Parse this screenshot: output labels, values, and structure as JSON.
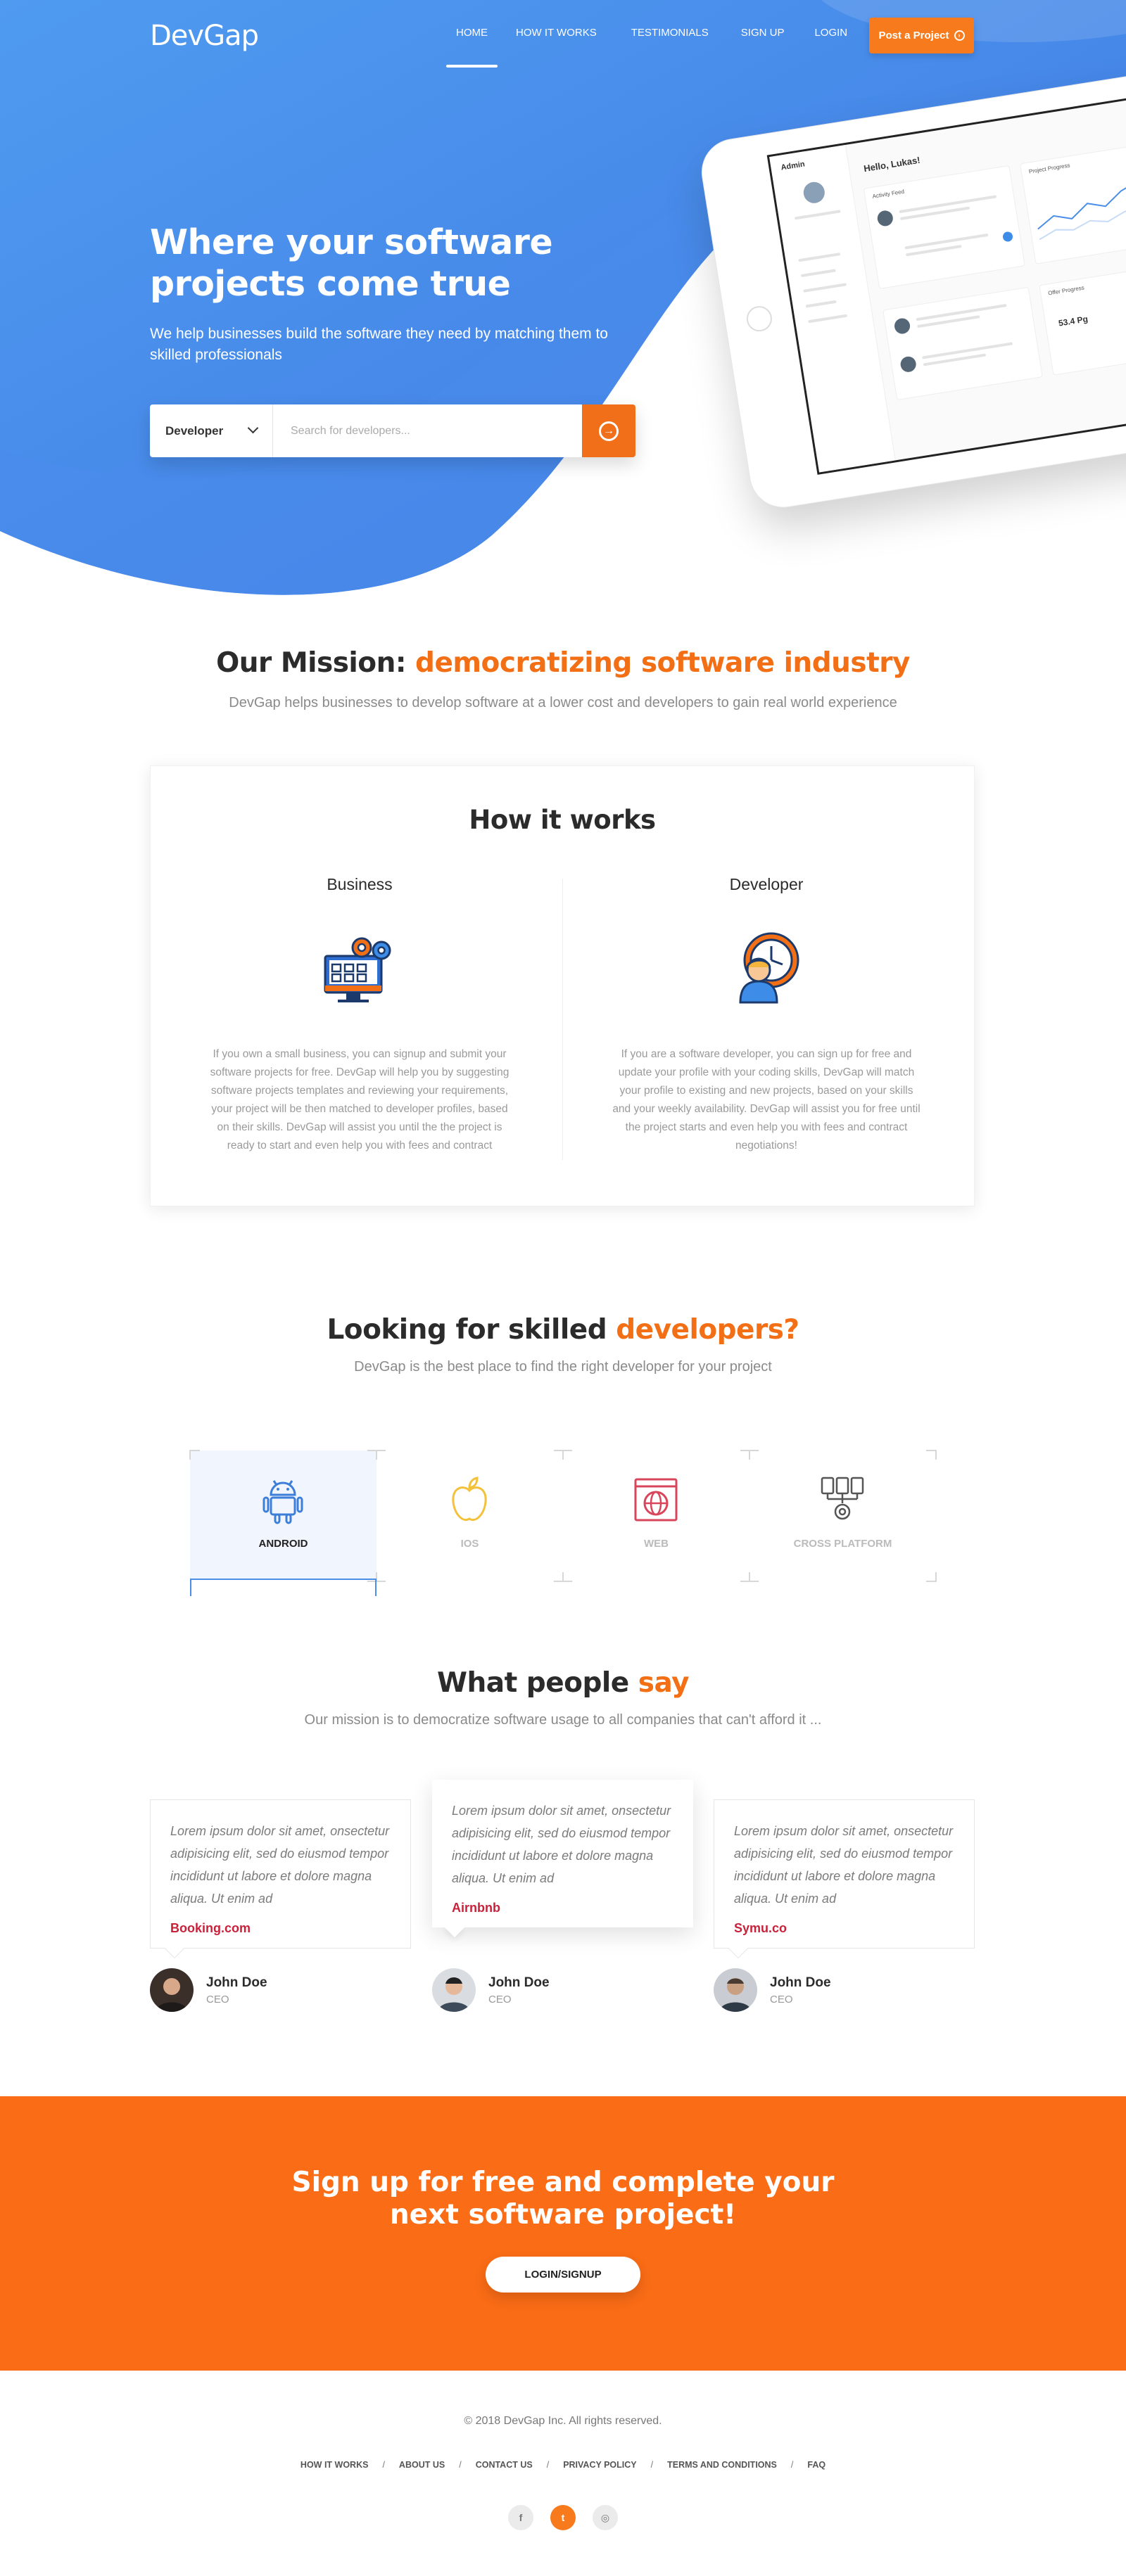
{
  "brand": {
    "logo": "DevGap",
    "accent": "#f36f16",
    "hero_blue": "#3f8be9"
  },
  "nav": {
    "items": [
      "HOME",
      "HOW IT WORKS",
      "TESTIMONIALS",
      "SIGN UP",
      "LOGIN"
    ],
    "active": "HOME",
    "post_button": "Post a Project"
  },
  "hero": {
    "title": "Where your software projects come true",
    "subtitle": "We help businesses build the software they need by matching them to skilled professionals",
    "search": {
      "selected": "Developer",
      "placeholder": "Search for developers...",
      "submit_icon": "arrow-circle-icon"
    }
  },
  "mission": {
    "title_start": "Our Mission:",
    "title_highlight": "democratizing software industry",
    "subtitle": "DevGap helps businesses to develop software at a lower cost and developers to gain real world experience"
  },
  "how": {
    "title": "How it works",
    "business": {
      "heading": "Business",
      "icon": "computer-gears-icon",
      "text": "If you own a small business, you can signup and submit your software projects for free. DevGap will help you by suggesting software projects templates and reviewing your requirements, your project will be then matched to developer profiles, based on their skills. DevGap will assist you until the the project is ready to start and even help you with fees and contract"
    },
    "developer": {
      "heading": "Developer",
      "icon": "developer-clock-icon",
      "text": "If you are a software developer, you can sign up for free and update your profile with your coding skills, DevGap will match your profile to existing and new projects, based on your skills and your weekly availability. DevGap will assist you for free until the project starts and even help you with fees and contract negotiations!"
    }
  },
  "developers": {
    "title_start": "Looking for skilled",
    "title_highlight": "developers?",
    "subtitle": "DevGap is the best place to find the right developer for your project",
    "categories": [
      {
        "label": "ANDROID",
        "icon": "android-icon",
        "active": true
      },
      {
        "label": "IOS",
        "icon": "apple-icon",
        "active": false
      },
      {
        "label": "WEB",
        "icon": "web-globe-icon",
        "active": false
      },
      {
        "label": "CROSS PLATFORM",
        "icon": "cross-platform-icon",
        "active": false
      }
    ]
  },
  "testimonials": {
    "title_start": "What people",
    "title_highlight": "say",
    "subtitle": "Our mission is to democratize software usage to all companies that can't afford it ...",
    "items": [
      {
        "quote": "Lorem ipsum dolor sit amet, onsectetur adipisicing elit, sed do eiusmod tempor incididunt ut labore et dolore magna aliqua. Ut enim ad",
        "company": "Booking.com",
        "name": "John Doe",
        "role": "CEO"
      },
      {
        "quote": "Lorem ipsum dolor sit amet, onsectetur adipisicing elit, sed do eiusmod tempor incididunt ut labore et dolore magna aliqua. Ut enim ad",
        "company": "Airnbnb",
        "name": "John Doe",
        "role": "CEO"
      },
      {
        "quote": "Lorem ipsum dolor sit amet, onsectetur adipisicing elit, sed do eiusmod tempor incididunt ut labore et dolore magna aliqua. Ut enim ad",
        "company": "Symu.co",
        "name": "John Doe",
        "role": "CEO"
      }
    ]
  },
  "cta": {
    "title_line1": "Sign up for free and complete your",
    "title_line2": "next software project!",
    "button": "LOGIN/SIGNUP"
  },
  "footer": {
    "copyright": "© 2018 DevGap Inc.  All rights reserved.",
    "links": [
      "HOW IT WORKS",
      "ABOUT US",
      "CONTACT US",
      "PRIVACY POLICY",
      "TERMS AND CONDITIONS",
      "FAQ"
    ],
    "social": [
      {
        "icon": "facebook-icon",
        "glyph": "f"
      },
      {
        "icon": "twitter-icon",
        "glyph": "t"
      },
      {
        "icon": "instagram-icon",
        "glyph": "◎"
      }
    ]
  },
  "tablet_mock": {
    "app_name": "Admin",
    "greeting": "Hello, Lukas!",
    "section_activity": "Activity Feed",
    "section_progress": "Project Progress",
    "section_offers": "Offer Progress",
    "stat": "53.4 Pg"
  }
}
